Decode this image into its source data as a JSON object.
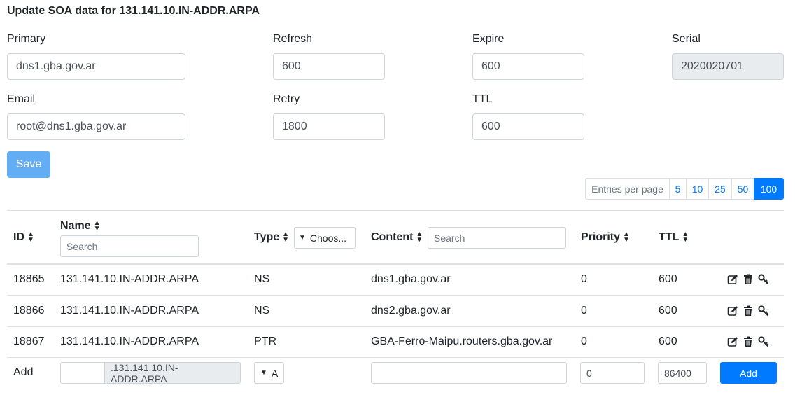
{
  "title": "Update SOA data for 131.141.10.IN-ADDR.ARPA",
  "soa": {
    "primary_label": "Primary",
    "primary_value": "dns1.gba.gov.ar",
    "refresh_label": "Refresh",
    "refresh_value": "600",
    "expire_label": "Expire",
    "expire_value": "600",
    "serial_label": "Serial",
    "serial_value": "2020020701",
    "email_label": "Email",
    "email_value": "root@dns1.gba.gov.ar",
    "retry_label": "Retry",
    "retry_value": "1800",
    "ttl_label": "TTL",
    "ttl_value": "600",
    "save_label": "Save"
  },
  "pagination": {
    "label": "Entries per page",
    "options": [
      "5",
      "10",
      "25",
      "50",
      "100"
    ],
    "active": "100"
  },
  "table": {
    "headers": {
      "id": "ID",
      "name": "Name",
      "type": "Type",
      "content": "Content",
      "priority": "Priority",
      "ttl": "TTL"
    },
    "name_filter_placeholder": "Search",
    "type_filter_label": "Choos...",
    "content_filter_placeholder": "Search",
    "rows": [
      {
        "id": "18865",
        "name": "131.141.10.IN-ADDR.ARPA",
        "type": "NS",
        "content": "dns1.gba.gov.ar",
        "priority": "0",
        "ttl": "600"
      },
      {
        "id": "18866",
        "name": "131.141.10.IN-ADDR.ARPA",
        "type": "NS",
        "content": "dns2.gba.gov.ar",
        "priority": "0",
        "ttl": "600"
      },
      {
        "id": "18867",
        "name": "131.141.10.IN-ADDR.ARPA",
        "type": "PTR",
        "content": "GBA-Ferro-Maipu.routers.gba.gov.ar",
        "priority": "0",
        "ttl": "600"
      }
    ],
    "add_row": {
      "label": "Add",
      "name_suffix": ".131.141.10.IN-ADDR.ARPA",
      "type_value": "A",
      "priority_value": "0",
      "ttl_value": "86400",
      "button_label": "Add"
    }
  },
  "icons": {
    "edit": "edit-icon",
    "delete": "trash-icon",
    "key": "key-icon",
    "sort": "sort-icon",
    "caret": "caret-down-icon"
  },
  "colors": {
    "primary": "#007bff",
    "save_disabled": "#63adf5",
    "readonly_bg": "#e9ecef"
  }
}
